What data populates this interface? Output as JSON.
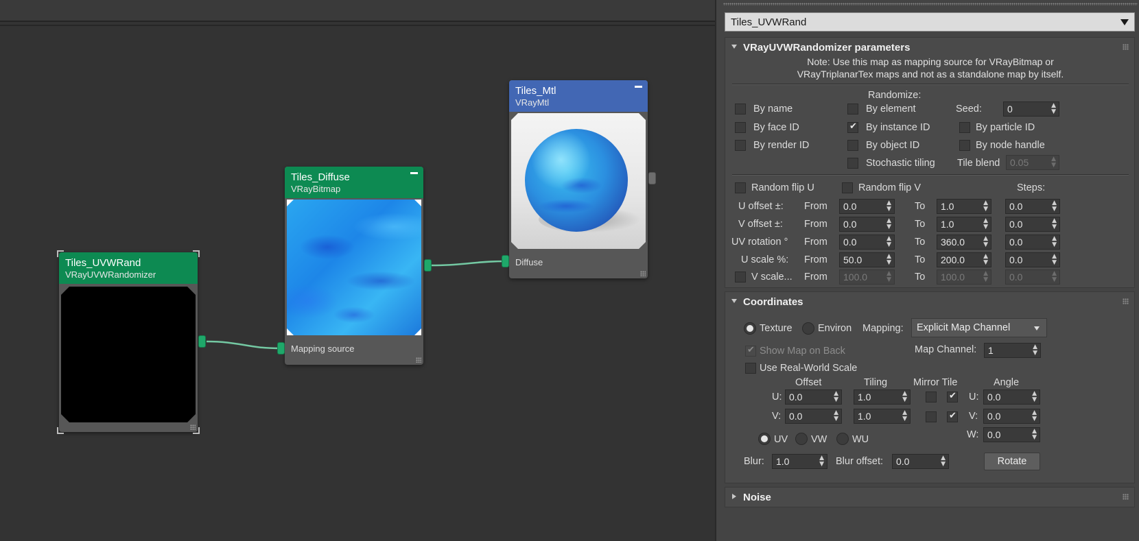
{
  "nodes": {
    "uvwrand": {
      "title": "Tiles_UVWRand",
      "subtitle": "VRayUVWRandomizer"
    },
    "diffuse": {
      "title": "Tiles_Diffuse",
      "subtitle": "VRayBitmap",
      "slot": "Mapping source"
    },
    "mtl": {
      "title": "Tiles_Mtl",
      "subtitle": "VRayMtl",
      "slot": "Diffuse"
    }
  },
  "panel": {
    "map_name": "Tiles_UVWRand",
    "randomizer": {
      "title": "VRayUVWRandomizer parameters",
      "note_line1": "Note: Use this map as mapping source for VRayBitmap or",
      "note_line2": "VRayTriplanarTex maps and not as a standalone map by itself.",
      "randomize_label": "Randomize:",
      "by_name": "By name",
      "by_element": "By element",
      "seed_label": "Seed:",
      "seed_value": "0",
      "by_face_id": "By face ID",
      "by_instance_id": "By instance ID",
      "by_particle_id": "By particle ID",
      "by_render_id": "By render ID",
      "by_object_id": "By object ID",
      "by_node_handle": "By node handle",
      "stochastic_tiling": "Stochastic tiling",
      "tile_blend_label": "Tile blend",
      "tile_blend_value": "0.05",
      "random_flip_u": "Random flip U",
      "random_flip_v": "Random flip V",
      "steps_label": "Steps:",
      "from_label": "From",
      "to_label": "To",
      "rows": [
        {
          "label": "U offset ±:",
          "from": "0.0",
          "to": "1.0",
          "steps": "0.0"
        },
        {
          "label": "V offset ±:",
          "from": "0.0",
          "to": "1.0",
          "steps": "0.0"
        },
        {
          "label": "UV rotation °",
          "from": "0.0",
          "to": "360.0",
          "steps": "0.0"
        },
        {
          "label": "U scale %:",
          "from": "50.0",
          "to": "200.0",
          "steps": "0.0"
        },
        {
          "label": "V scale...",
          "from": "100.0",
          "to": "100.0",
          "steps": "0.0"
        }
      ]
    },
    "coordinates": {
      "title": "Coordinates",
      "texture": "Texture",
      "environ": "Environ",
      "mapping_label": "Mapping:",
      "mapping_value": "Explicit Map Channel",
      "show_map_on_back": "Show Map on Back",
      "map_channel_label": "Map Channel:",
      "map_channel_value": "1",
      "use_real_world_scale": "Use Real-World Scale",
      "offset_label": "Offset",
      "tiling_label": "Tiling",
      "mirror_tile_label": "Mirror Tile",
      "angle_label": "Angle",
      "u_label": "U:",
      "v_label": "V:",
      "w_label": "W:",
      "u_offset": "0.0",
      "v_offset": "0.0",
      "u_tiling": "1.0",
      "v_tiling": "1.0",
      "u_angle": "0.0",
      "v_angle": "0.0",
      "w_angle": "0.0",
      "uv": "UV",
      "vw": "VW",
      "wu": "WU",
      "blur_label": "Blur:",
      "blur_value": "1.0",
      "blur_offset_label": "Blur offset:",
      "blur_offset_value": "0.0",
      "rotate_button": "Rotate"
    },
    "noise": {
      "title": "Noise"
    }
  }
}
